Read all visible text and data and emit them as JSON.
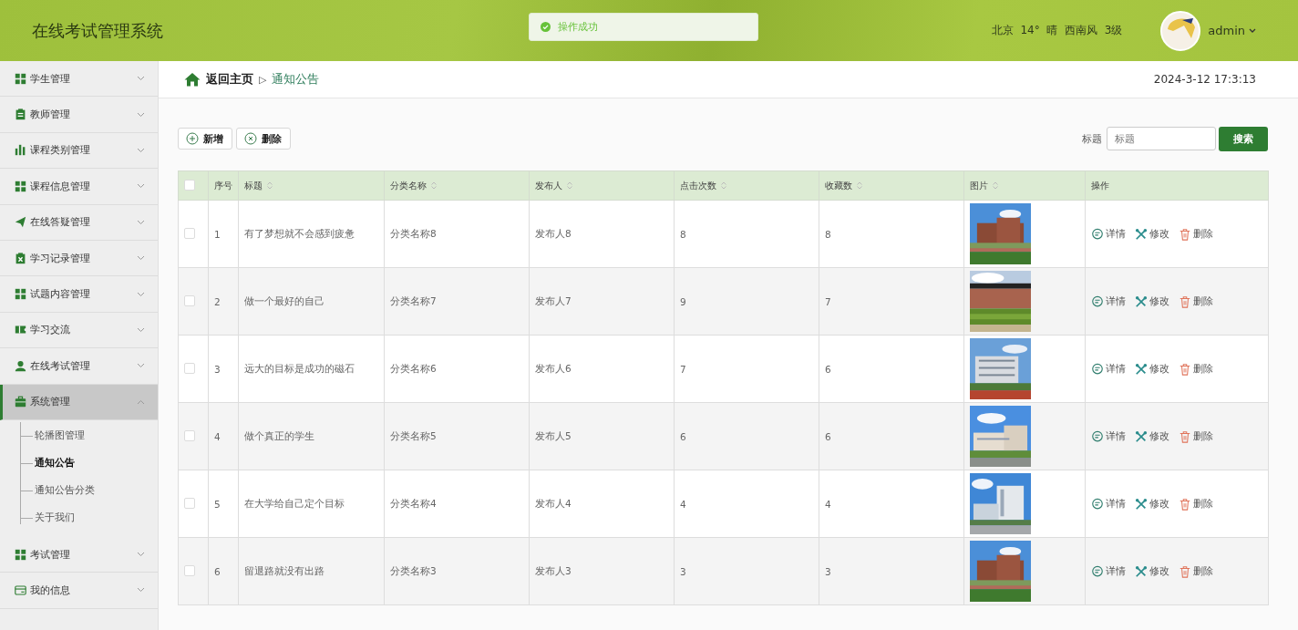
{
  "header": {
    "title": "在线考试管理系统",
    "toast": "操作成功",
    "weather": "北京  14°  晴  西南风  3级",
    "user": "admin"
  },
  "sidebar": {
    "items": [
      {
        "label": "学生管理",
        "kind": "grid",
        "selected": false,
        "expanded": false
      },
      {
        "label": "教师管理",
        "kind": "clipboard",
        "selected": false,
        "expanded": false
      },
      {
        "label": "课程类别管理",
        "kind": "bars",
        "selected": false,
        "expanded": false
      },
      {
        "label": "课程信息管理",
        "kind": "grid",
        "selected": false,
        "expanded": false
      },
      {
        "label": "在线答疑管理",
        "kind": "plane",
        "selected": false,
        "expanded": false
      },
      {
        "label": "学习记录管理",
        "kind": "clipx",
        "selected": false,
        "expanded": false
      },
      {
        "label": "试题内容管理",
        "kind": "grid",
        "selected": false,
        "expanded": false
      },
      {
        "label": "学习交流",
        "kind": "ticket",
        "selected": false,
        "expanded": false
      },
      {
        "label": "在线考试管理",
        "kind": "person",
        "selected": false,
        "expanded": false
      },
      {
        "label": "系统管理",
        "kind": "briefcase",
        "selected": true,
        "expanded": true,
        "children": [
          {
            "label": "轮播图管理",
            "selected": false
          },
          {
            "label": "通知公告",
            "selected": true
          },
          {
            "label": "通知公告分类",
            "selected": false
          },
          {
            "label": "关于我们",
            "selected": false
          }
        ]
      },
      {
        "label": "考试管理",
        "kind": "grid",
        "selected": false,
        "expanded": false
      },
      {
        "label": "我的信息",
        "kind": "card",
        "selected": false,
        "expanded": false
      }
    ]
  },
  "breadcrumb": {
    "home": "返回主页",
    "separator": "▷",
    "current": "通知公告",
    "datetime": "2024-3-12 17:3:13"
  },
  "toolbar": {
    "buttons": [
      {
        "label": "新增",
        "kind": "add"
      },
      {
        "label": "删除",
        "kind": "remove"
      }
    ],
    "search_label": "标题",
    "search": {
      "placeholder": "标题"
    },
    "search_button": "搜索"
  },
  "table": {
    "header_checked": false,
    "columns": [
      {
        "label": "序号",
        "sortable": false
      },
      {
        "label": "标题",
        "sortable": true
      },
      {
        "label": "分类名称",
        "sortable": true
      },
      {
        "label": "发布人",
        "sortable": true
      },
      {
        "label": "点击次数",
        "sortable": true
      },
      {
        "label": "收藏数",
        "sortable": true
      },
      {
        "label": "图片",
        "sortable": true
      },
      {
        "label": "操作",
        "sortable": false
      }
    ],
    "rows": [
      {
        "checked": false,
        "cells": [
          "1",
          "有了梦想就不会感到疲惫",
          "分类名称8",
          "发布人8",
          "8",
          "8"
        ],
        "picture": {
          "kind": "picture"
        },
        "actions": [
          {
            "label": "详情",
            "kind": "detail"
          },
          {
            "label": "修改",
            "kind": "edit"
          },
          {
            "label": "删除",
            "kind": "delete"
          }
        ]
      },
      {
        "checked": false,
        "cells": [
          "2",
          "做一个最好的自己",
          "分类名称7",
          "发布人7",
          "9",
          "7"
        ],
        "picture": {
          "kind": "picture"
        },
        "actions": [
          {
            "label": "详情",
            "kind": "detail"
          },
          {
            "label": "修改",
            "kind": "edit"
          },
          {
            "label": "删除",
            "kind": "delete"
          }
        ]
      },
      {
        "checked": false,
        "cells": [
          "3",
          "远大的目标是成功的磁石",
          "分类名称6",
          "发布人6",
          "7",
          "6"
        ],
        "picture": {
          "kind": "picture"
        },
        "actions": [
          {
            "label": "详情",
            "kind": "detail"
          },
          {
            "label": "修改",
            "kind": "edit"
          },
          {
            "label": "删除",
            "kind": "delete"
          }
        ]
      },
      {
        "checked": false,
        "cells": [
          "4",
          "做个真正的学生",
          "分类名称5",
          "发布人5",
          "6",
          "6"
        ],
        "picture": {
          "kind": "picture"
        },
        "actions": [
          {
            "label": "详情",
            "kind": "detail"
          },
          {
            "label": "修改",
            "kind": "edit"
          },
          {
            "label": "删除",
            "kind": "delete"
          }
        ]
      },
      {
        "checked": false,
        "cells": [
          "5",
          "在大学给自己定个目标",
          "分类名称4",
          "发布人4",
          "4",
          "4"
        ],
        "picture": {
          "kind": "picture"
        },
        "actions": [
          {
            "label": "详情",
            "kind": "detail"
          },
          {
            "label": "修改",
            "kind": "edit"
          },
          {
            "label": "删除",
            "kind": "delete"
          }
        ]
      },
      {
        "checked": false,
        "cells": [
          "6",
          "留退路就没有出路",
          "分类名称3",
          "发布人3",
          "3",
          "3"
        ],
        "picture": {
          "kind": "picture"
        },
        "actions": [
          {
            "label": "详情",
            "kind": "detail"
          },
          {
            "label": "修改",
            "kind": "edit"
          },
          {
            "label": "删除",
            "kind": "delete"
          }
        ]
      }
    ]
  }
}
